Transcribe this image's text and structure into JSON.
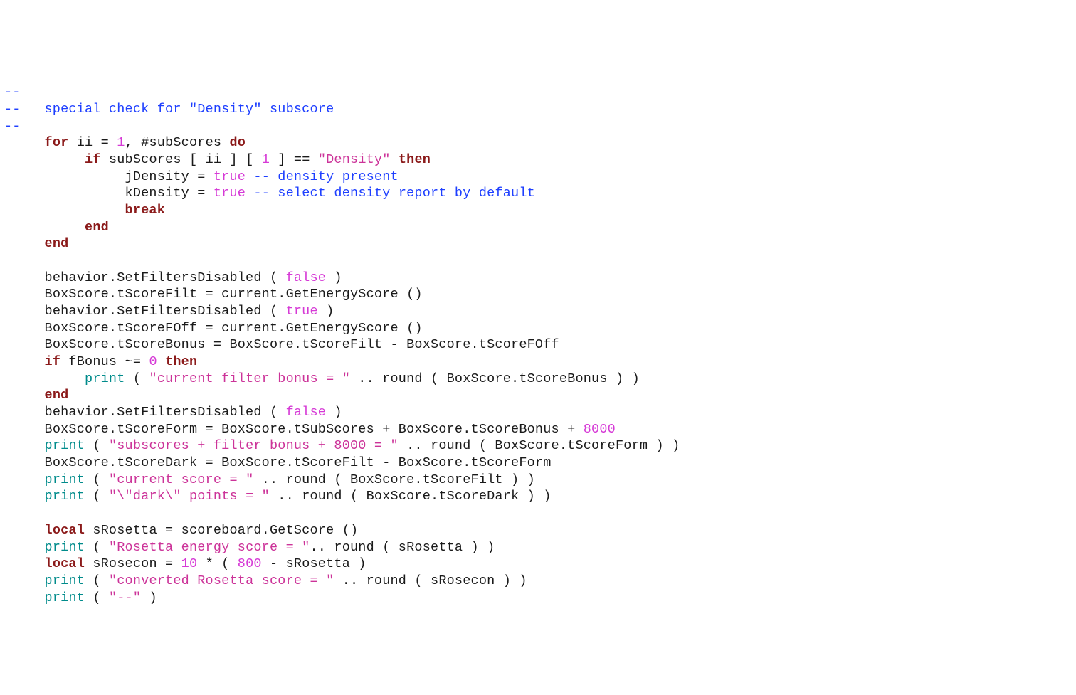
{
  "lines": {
    "l01_a": "--",
    "l02_a": "--   special check for \"Density\" subscore",
    "l03_a": "--",
    "l04_kw1": "for",
    "l04_a": " ii = ",
    "l04_n1": "1",
    "l04_b": ", #subScores ",
    "l04_kw2": "do",
    "l05_kw1": "if",
    "l05_a": " subScores [ ii ] [ ",
    "l05_n1": "1",
    "l05_b": " ] == ",
    "l05_s1": "\"Density\"",
    "l05_c": " ",
    "l05_kw2": "then",
    "l06_a": "jDensity = ",
    "l06_b1": "true",
    "l06_c": " ",
    "l06_cm": "-- density present",
    "l07_a": "kDensity = ",
    "l07_b1": "true",
    "l07_c": " ",
    "l07_cm": "-- select density report by default",
    "l08_kw": "break",
    "l09_kw": "end",
    "l10_kw": "end",
    "l12_a": "behavior.SetFiltersDisabled ( ",
    "l12_b1": "false",
    "l12_c": " )",
    "l13_a": "BoxScore.tScoreFilt = current.GetEnergyScore ()",
    "l14_a": "behavior.SetFiltersDisabled ( ",
    "l14_b1": "true",
    "l14_c": " )",
    "l15_a": "BoxScore.tScoreFOff = current.GetEnergyScore ()",
    "l16_a": "BoxScore.tScoreBonus = BoxScore.tScoreFilt - BoxScore.tScoreFOff",
    "l17_kw1": "if",
    "l17_a": " fBonus ~= ",
    "l17_n1": "0",
    "l17_b": " ",
    "l17_kw2": "then",
    "l18_fn": "print",
    "l18_a": " ( ",
    "l18_s": "\"current filter bonus = \"",
    "l18_b": " .. round ( BoxScore.tScoreBonus ) )",
    "l19_kw": "end",
    "l20_a": "behavior.SetFiltersDisabled ( ",
    "l20_b1": "false",
    "l20_c": " )",
    "l21_a": "BoxScore.tScoreForm = BoxScore.tSubScores + BoxScore.tScoreBonus + ",
    "l21_n": "8000",
    "l22_fn": "print",
    "l22_a": " ( ",
    "l22_s": "\"subscores + filter bonus + 8000 = \"",
    "l22_b": " .. round ( BoxScore.tScoreForm ) )",
    "l23_a": "BoxScore.tScoreDark = BoxScore.tScoreFilt - BoxScore.tScoreForm",
    "l24_fn": "print",
    "l24_a": " ( ",
    "l24_s": "\"current score = \"",
    "l24_b": " .. round ( BoxScore.tScoreFilt ) )",
    "l25_fn": "print",
    "l25_a": " ( ",
    "l25_s": "\"\\\"dark\\\" points = \"",
    "l25_b": " .. round ( BoxScore.tScoreDark ) )",
    "l27_kw": "local",
    "l27_a": " sRosetta = scoreboard.GetScore ()",
    "l28_fn": "print",
    "l28_a": " ( ",
    "l28_s": "\"Rosetta energy score = \"",
    "l28_b": ".. round ( sRosetta ) )",
    "l29_kw": "local",
    "l29_a": " sRosecon = ",
    "l29_n1": "10",
    "l29_b": " * ( ",
    "l29_n2": "800",
    "l29_c": " - sRosetta )",
    "l30_fn": "print",
    "l30_a": " ( ",
    "l30_s": "\"converted Rosetta score = \"",
    "l30_b": " .. round ( sRosecon ) )",
    "l31_fn": "print",
    "l31_a": " ( ",
    "l31_s": "\"--\"",
    "l31_b": " )"
  }
}
